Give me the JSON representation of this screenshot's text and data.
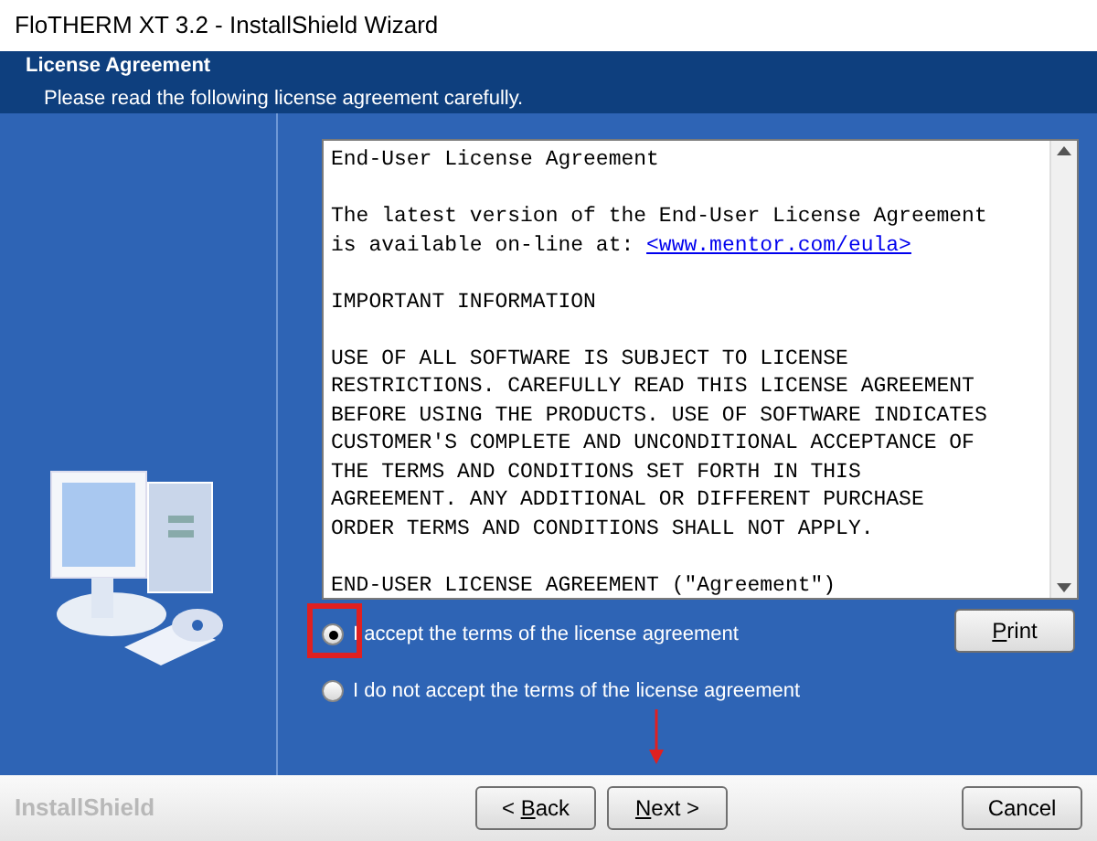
{
  "window": {
    "title": "FloTHERM XT 3.2 - InstallShield Wizard"
  },
  "header": {
    "title": "License Agreement",
    "subtitle": "Please read the following license agreement carefully."
  },
  "license": {
    "paragraphs": [
      {
        "lines": [
          "End-User License Agreement"
        ]
      },
      {
        "lines": [
          "The latest version of the End-User License Agreement"
        ],
        "link_prefix": "is available on-line at: ",
        "link": "<www.mentor.com/eula>"
      },
      {
        "lines": [
          "IMPORTANT INFORMATION"
        ]
      },
      {
        "lines": [
          "USE OF ALL SOFTWARE IS SUBJECT TO LICENSE",
          "RESTRICTIONS. CAREFULLY READ THIS LICENSE AGREEMENT",
          "BEFORE USING THE PRODUCTS. USE OF SOFTWARE INDICATES",
          "CUSTOMER'S COMPLETE AND UNCONDITIONAL ACCEPTANCE OF",
          "THE TERMS AND CONDITIONS SET FORTH IN THIS",
          "AGREEMENT. ANY ADDITIONAL OR DIFFERENT PURCHASE",
          "ORDER TERMS AND CONDITIONS SHALL NOT APPLY."
        ]
      },
      {
        "lines": [
          "END-USER LICENSE AGREEMENT (\"Agreement\")"
        ]
      }
    ]
  },
  "options": [
    {
      "label": "I accept the terms of the license agreement",
      "selected": true
    },
    {
      "label": "I do not accept the terms of the license agreement",
      "selected": false
    }
  ],
  "print_button": {
    "mnemonic": "P",
    "rest": "rint"
  },
  "brand": "InstallShield",
  "buttons": [
    {
      "before": "< ",
      "mnemonic": "B",
      "rest": "ack"
    },
    {
      "mnemonic": "N",
      "rest": "ext >"
    }
  ],
  "cancel_button": {
    "label": "Cancel"
  }
}
